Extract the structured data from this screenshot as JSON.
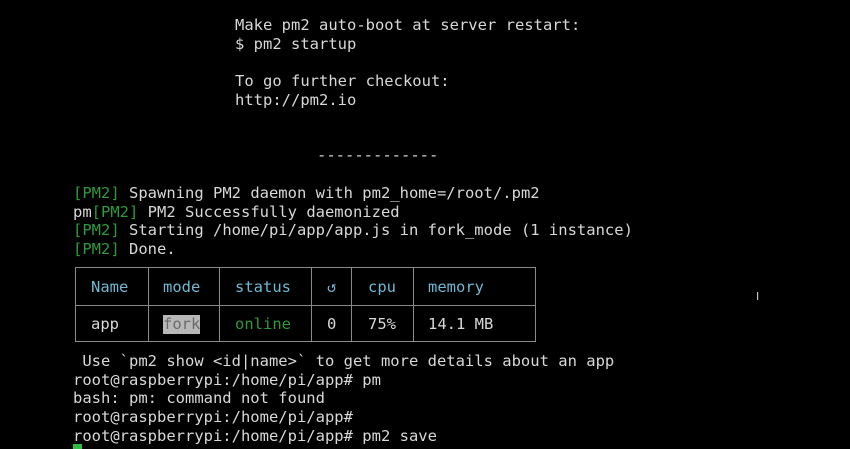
{
  "banner": {
    "autoboot_title": "Make pm2 auto-boot at server restart:",
    "autoboot_cmd": "$ pm2 startup",
    "further_title": "To go further checkout:",
    "further_url": "http://pm2.io",
    "separator": "-------------"
  },
  "log": [
    {
      "prefix": "",
      "tag": "[PM2]",
      "text": " Spawning PM2 daemon with pm2_home=/root/.pm2"
    },
    {
      "prefix": "pm",
      "tag": "[PM2]",
      "text": " PM2 Successfully daemonized"
    },
    {
      "prefix": "",
      "tag": "[PM2]",
      "text": " Starting /home/pi/app/app.js in fork_mode (1 instance)"
    },
    {
      "prefix": "",
      "tag": "[PM2]",
      "text": " Done."
    }
  ],
  "process_table": {
    "headers": {
      "name": "Name",
      "mode": "mode",
      "status": "status",
      "restarts": "↺",
      "cpu": "cpu",
      "memory": "memory"
    },
    "row": {
      "name": "app",
      "mode": "fork",
      "status": "online",
      "restarts": "0",
      "cpu": "75%",
      "memory": "14.1 MB"
    }
  },
  "hint": " Use `pm2 show <id|name>` to get more details about an app",
  "session": [
    "root@raspberrypi:/home/pi/app# pm",
    "bash: pm: command not found",
    "root@raspberrypi:/home/pi/app#",
    "root@raspberrypi:/home/pi/app# pm2 save"
  ],
  "colors": {
    "background": "#000000",
    "text": "#d8d8d8",
    "pm2_tag": "#2e9a3c",
    "table_header": "#6fb7d2",
    "status_online": "#2e9a3c",
    "cursor": "#2fbd3d"
  }
}
